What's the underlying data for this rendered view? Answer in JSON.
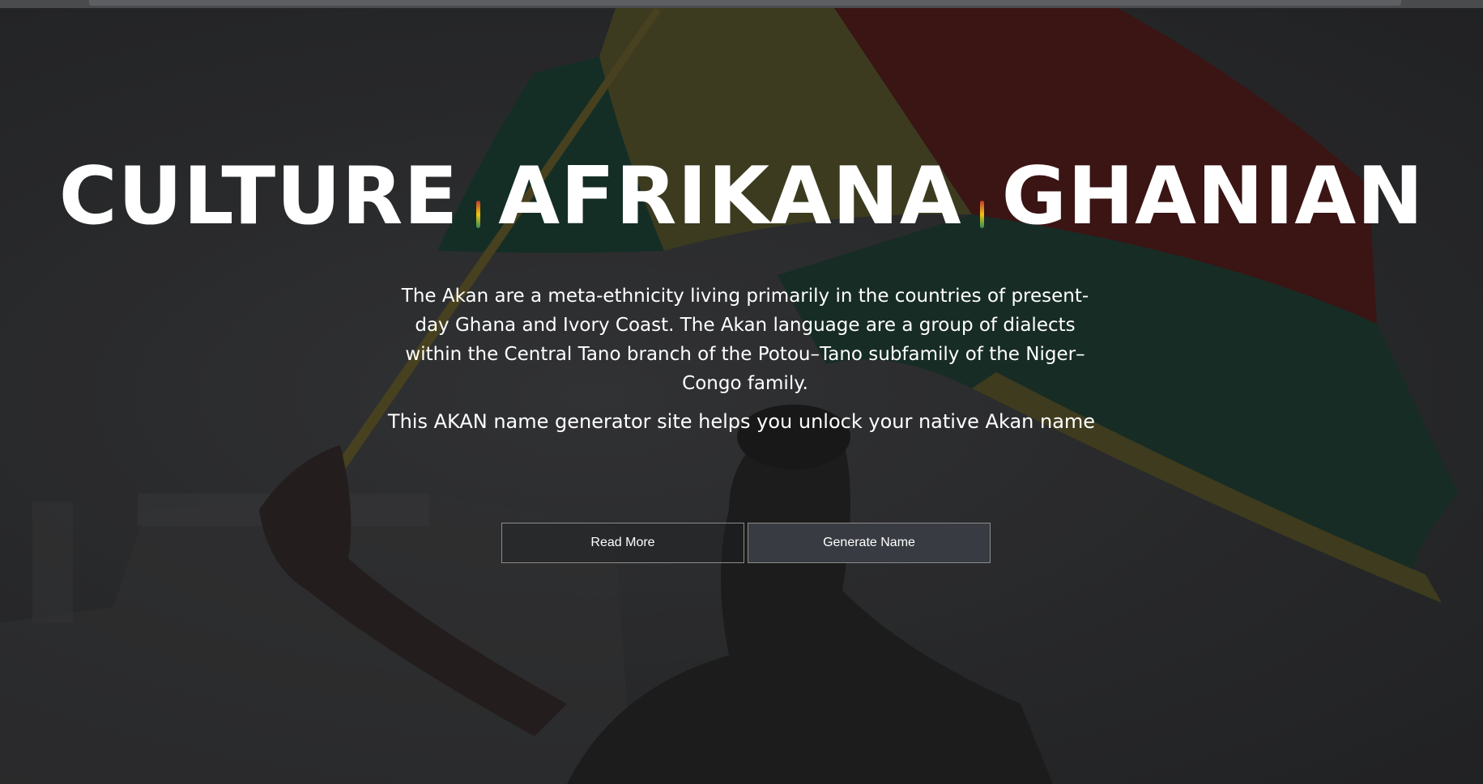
{
  "hero": {
    "title_words": [
      "CULTURE",
      "AFRIKANA",
      "GHANIAN"
    ],
    "description": "The Akan are a meta-ethnicity living primarily in the countries of present-day Ghana and Ivory Coast. The Akan language are a group of dialects within the Central Tano branch of the Potou–Tano subfamily of the Niger–Congo family.",
    "tagline": "This AKAN name generator site helps you unlock your native Akan name"
  },
  "actions": {
    "read_more_label": "Read More",
    "generate_label": "Generate Name"
  },
  "colors": {
    "flag_red": "#c0392b",
    "flag_gold": "#f1c40f",
    "flag_green": "#2e8b57",
    "button_dark": "#383b41"
  }
}
